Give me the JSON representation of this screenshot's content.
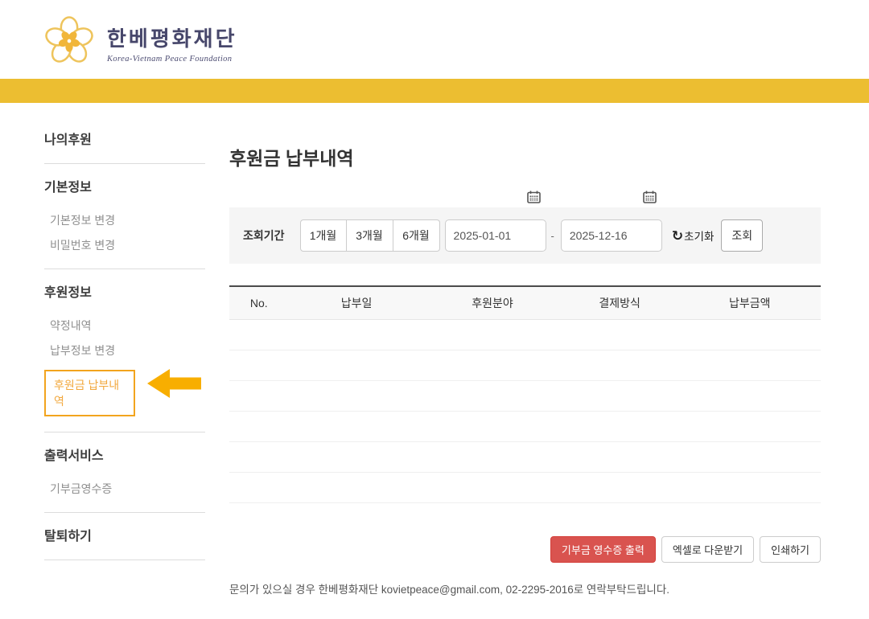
{
  "header": {
    "logo": {
      "korean_name": "한베평화재단",
      "english_name": "Korea-Vietnam Peace Foundation"
    }
  },
  "colors": {
    "accent_yellow": "#ecbe31",
    "highlight_orange": "#f2a41e",
    "arrow_orange": "#f8ae00",
    "danger_red": "#d9534f"
  },
  "sidebar": {
    "active_item": "후원금 납부내역",
    "sections": [
      {
        "title": "나의후원",
        "items": []
      },
      {
        "title": "기본정보",
        "items": [
          "기본정보 변경",
          "비밀번호 변경"
        ]
      },
      {
        "title": "후원정보",
        "items": [
          "약정내역",
          "납부정보 변경",
          "후원금 납부내역"
        ]
      },
      {
        "title": "출력서비스",
        "items": [
          "기부금영수증"
        ]
      },
      {
        "title": "탈퇴하기",
        "items": []
      }
    ]
  },
  "main": {
    "title": "후원금 납부내역",
    "filter": {
      "label": "조회기간",
      "period_buttons": [
        "1개월",
        "3개월",
        "6개월"
      ],
      "date_from": "2025-01-01",
      "date_separator": "-",
      "date_to": "2025-12-16",
      "reset_icon_glyph": "↻",
      "reset_label": "초기화",
      "search_label": "조회"
    },
    "table": {
      "columns": [
        "No.",
        "납부일",
        "후원분야",
        "결제방식",
        "납부금액"
      ],
      "rows": [],
      "empty_row_count": 6
    },
    "actions": {
      "receipt_label": "기부금 영수증 출력",
      "excel_label": "엑셀로 다운받기",
      "print_label": "인쇄하기"
    },
    "footer_note": "문의가 있으실 경우 한베평화재단 kovietpeace@gmail.com, 02-2295-2016로 연락부탁드립니다."
  }
}
